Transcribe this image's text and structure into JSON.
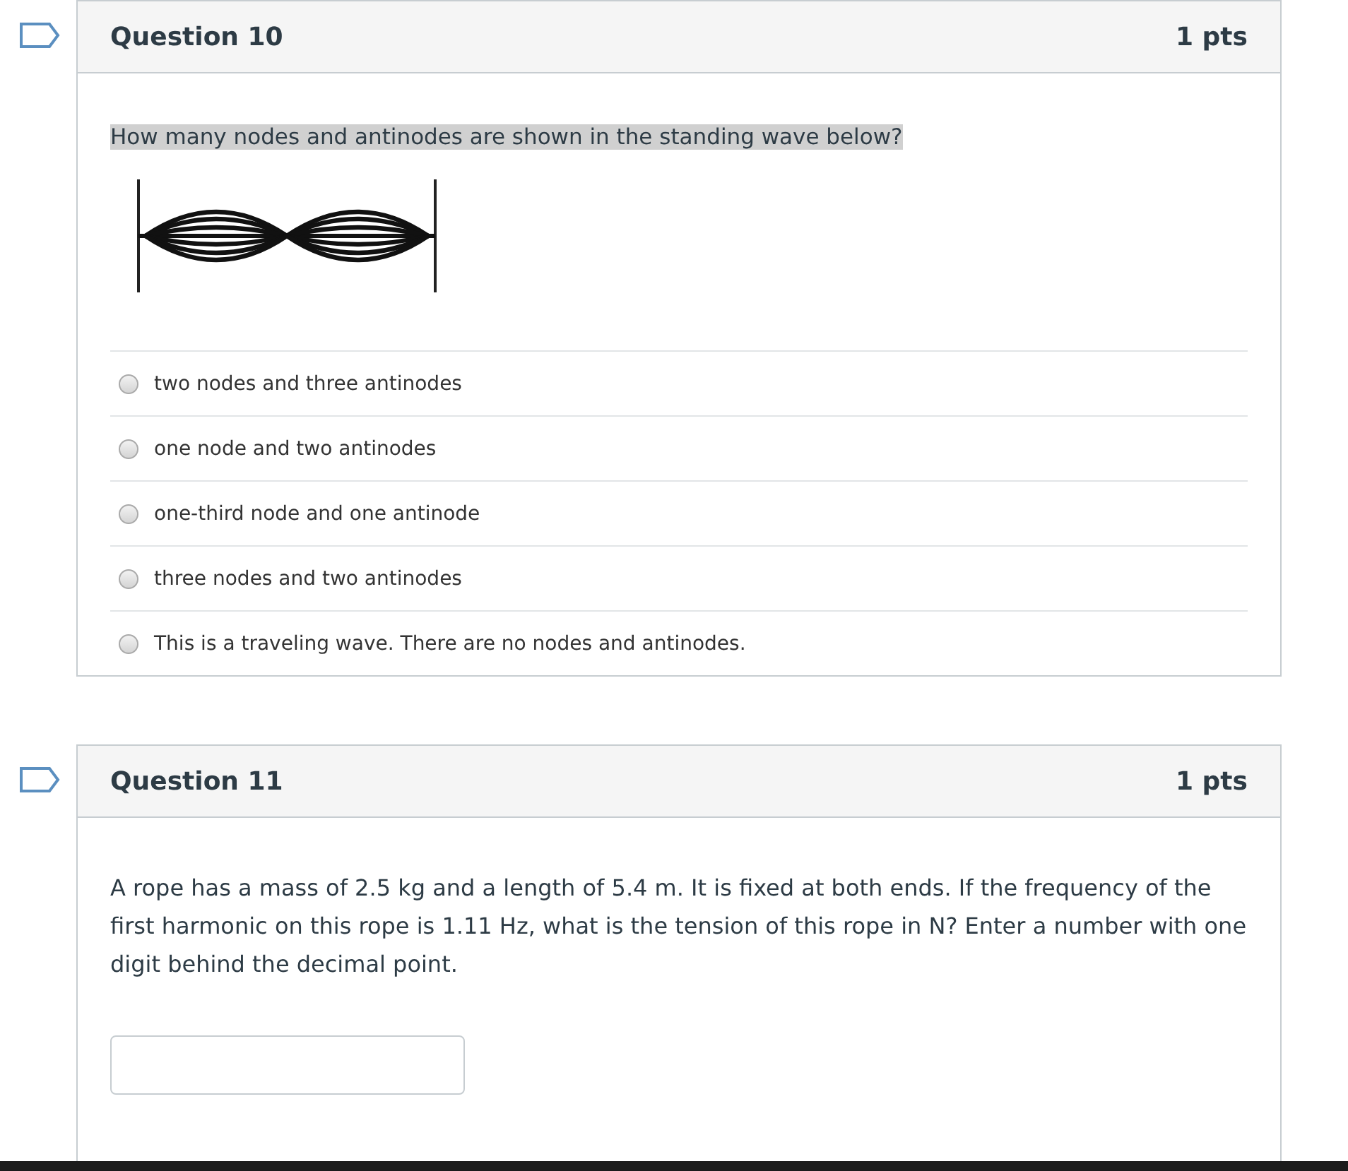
{
  "questions": [
    {
      "title": "Question 10",
      "points": "1 pts",
      "kind": "multiple_choice",
      "prompt": "How many nodes and antinodes are shown in the standing wave below?",
      "prompt_highlighted": true,
      "options": [
        {
          "label": "two nodes and three antinodes",
          "selected": false
        },
        {
          "label": "one node and two antinodes",
          "selected": false
        },
        {
          "label": "one-third node and one antinode",
          "selected": false
        },
        {
          "label": "three nodes and two antinodes",
          "selected": false
        },
        {
          "label": "This is a traveling wave. There are no nodes and antinodes.",
          "selected": false
        }
      ]
    },
    {
      "title": "Question 11",
      "points": "1 pts",
      "kind": "numeric",
      "prompt": "A rope has a mass of 2.5 kg and a length of 5.4 m. It is fixed at both ends. If the frequency of the first harmonic on this rope is 1.11 Hz, what is the tension of this rope in N? Enter a number with one digit behind the decimal point.",
      "prompt_highlighted": false
    }
  ]
}
